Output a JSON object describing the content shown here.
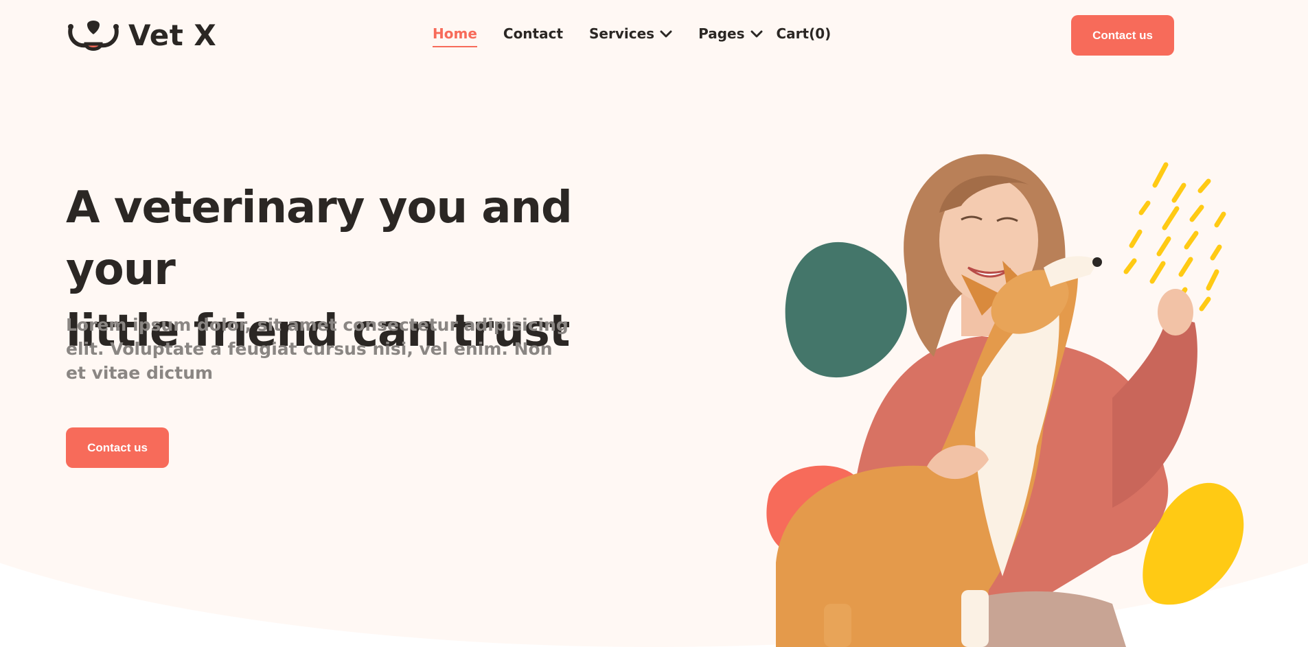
{
  "brand": {
    "name": "Vet X",
    "logo_icon": "dog-face-logo-icon"
  },
  "nav": {
    "items": [
      {
        "label": "Home",
        "active": true,
        "dropdown": false
      },
      {
        "label": "Contact",
        "active": false,
        "dropdown": false
      },
      {
        "label": "Services",
        "active": false,
        "dropdown": true
      },
      {
        "label": "Pages",
        "active": false,
        "dropdown": true
      }
    ],
    "cart_label": "Cart(0)"
  },
  "header": {
    "cta_label": "Contact us"
  },
  "hero": {
    "headline_line1": "A veterinary you and your",
    "headline_line2": "little friend can trust",
    "subtext": "Lorem ipsum dolor, sit amet consectetur adipisicing elit. Voluptate a feugiat cursus nisi, vel enim. Non et vitae dictum",
    "cta_label": "Contact us"
  },
  "colors": {
    "accent": "#f76b5a",
    "text_dark": "#2b2724",
    "text_muted": "#8a8683",
    "background": "#fff8f4",
    "blob_green": "#44766a",
    "blob_yellow": "#ffca14"
  }
}
